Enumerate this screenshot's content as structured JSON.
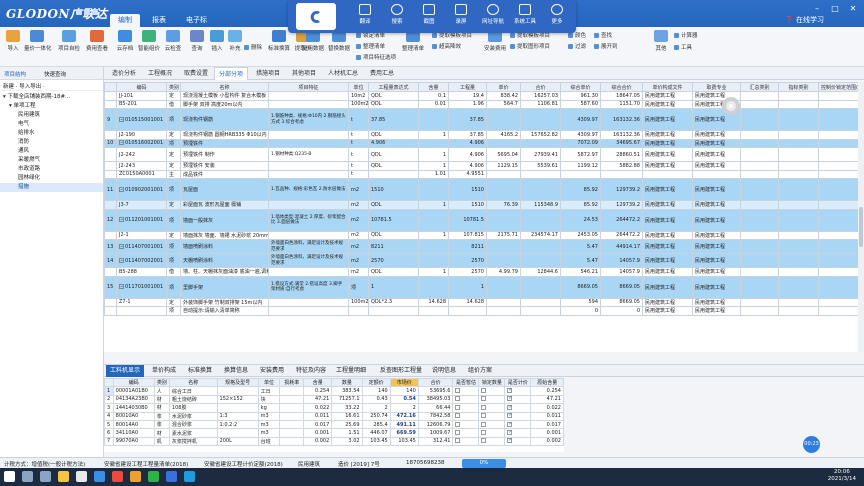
{
  "titlebar": {
    "logo": "GLODON广联达",
    "menu_tabs": [
      "编制",
      "报表",
      "电子标"
    ],
    "online_learning": "在线学习"
  },
  "floating_toolbar": {
    "buttons": [
      "翻译",
      "搜索",
      "截图",
      "录屏",
      "网址导航",
      "系统工具",
      "更多"
    ]
  },
  "ribbon": {
    "buttons": [
      "导入",
      "量价一体化",
      "项目自检",
      "费用查看",
      "云存档",
      "智能组价",
      "云检查",
      "查询",
      "插入",
      "补充",
      "删除",
      "标准换算",
      "提取价",
      "复用数据",
      "替换数据",
      "锁定清单",
      "整理清单",
      "超高降效",
      "安装费用",
      "批量换算",
      "其他",
      "工具"
    ],
    "small": [
      "锁定清单",
      "整理清单",
      "项目特征选项",
      "提取模板项目",
      "提取图形项目",
      "颜色",
      "展开到",
      "查找",
      "过滤",
      "计算器"
    ]
  },
  "left_panel": {
    "tabs": [
      "项目结构",
      "快速查询"
    ],
    "toolbar": "新建 · 导入导出 ·",
    "tree": [
      {
        "label": "下载全店铺装西期-18#...",
        "level": 0
      },
      {
        "label": "单项工程",
        "level": 1
      },
      {
        "label": "民用建筑",
        "level": 2
      },
      {
        "label": "电气",
        "level": 2
      },
      {
        "label": "给排水",
        "level": 2
      },
      {
        "label": "消防",
        "level": 2
      },
      {
        "label": "通风",
        "level": 2
      },
      {
        "label": "采暖燃气",
        "level": 2
      },
      {
        "label": "市政道路",
        "level": 2
      },
      {
        "label": "园林绿化",
        "level": 2
      },
      {
        "label": "措施",
        "level": 2,
        "selected": true
      }
    ]
  },
  "content_tabs": [
    "造价分析",
    "工程概况",
    "取费设置",
    "分部分项",
    "措施项目",
    "其他项目",
    "人材机汇总",
    "费用汇总"
  ],
  "active_content_tab": "分部分项",
  "grid": {
    "headers": [
      "",
      "编码",
      "类别",
      "名称",
      "项目特征",
      "单位",
      "工程量表达式",
      "含量",
      "工程量",
      "单价",
      "合价",
      "综合单价",
      "综合合价",
      "单价构成文件",
      "取费专业",
      "汇总类别",
      "指标类别",
      "控制价锁定范围(%)"
    ],
    "rows": [
      {
        "no": "",
        "code": "JJ-101",
        "cat": "定",
        "name": "现浇混凝土模板 小型构件 复合木模板",
        "feat": "",
        "unit": "10m2",
        "expr": "QDL",
        "qty": "0.1",
        "amount": "19.4",
        "price": "838.42",
        "total": "16257.03",
        "cunit": "961.30",
        "ctotal": "18647.05",
        "file": "民用建筑工程",
        "spec": "民用建筑工程",
        "style": "white"
      },
      {
        "no": "",
        "code": "B5-201",
        "cat": "借",
        "name": "脚手架 双排 高度20m以内",
        "feat": "",
        "unit": "100m2",
        "expr": "QDL",
        "qty": "0.01",
        "amount": "1.96",
        "price": "564.7",
        "total": "1106.81",
        "cunit": "587.60",
        "ctotal": "1151.70",
        "file": "民用建筑工程",
        "spec": "民用建筑工程",
        "style": "white"
      },
      {
        "no": "9",
        "code": "010515001001",
        "cat": "项",
        "name": "现浇构件钢筋",
        "feat": "1.钢筋种类、规格:Φ10内\n2.钢筋接头方式\n3.综合考虑",
        "unit": "t",
        "expr": "37.85",
        "qty": "",
        "amount": "37.85",
        "price": "",
        "total": "",
        "cunit": "4309.97",
        "ctotal": "163132.36",
        "file": "民用建筑工程",
        "spec": "民用建筑工程",
        "style": "blue"
      },
      {
        "no": "",
        "code": "J2-190",
        "cat": "定",
        "name": "现浇构件钢筋 圆钢HRB335 Φ10以内",
        "feat": "",
        "unit": "t",
        "expr": "QDL",
        "qty": "1",
        "amount": "37.85",
        "price": "4165.2",
        "total": "157652.82",
        "cunit": "4309.97",
        "ctotal": "163132.36",
        "file": "民用建筑工程",
        "spec": "民用建筑工程",
        "style": "white"
      },
      {
        "no": "10",
        "code": "010516002001",
        "cat": "项",
        "name": "预埋铁件",
        "feat": "",
        "unit": "t",
        "expr": "4.906",
        "qty": "",
        "amount": "4.906",
        "price": "",
        "total": "",
        "cunit": "7072.09",
        "ctotal": "34695.67",
        "file": "民用建筑工程",
        "spec": "民用建筑工程",
        "style": "blue"
      },
      {
        "no": "",
        "code": "J2-242",
        "cat": "定",
        "name": "预埋铁件 制作",
        "feat": "1.钢材种类:Q235-B",
        "unit": "t",
        "expr": "QDL",
        "qty": "1",
        "amount": "4.906",
        "price": "5695.04",
        "total": "27939.41",
        "cunit": "5872.97",
        "ctotal": "28860.51",
        "file": "民用建筑工程",
        "spec": "民用建筑工程",
        "style": "white"
      },
      {
        "no": "",
        "code": "J2-243",
        "cat": "定",
        "name": "预埋铁件 安装",
        "feat": "",
        "unit": "t",
        "expr": "QDL",
        "qty": "1",
        "amount": "4.906",
        "price": "1129.15",
        "total": "5539.61",
        "cunit": "1199.12",
        "ctotal": "5882.88",
        "file": "民用建筑工程",
        "spec": "民用建筑工程",
        "style": "white"
      },
      {
        "no": "",
        "code": "ZC0150A0001",
        "cat": "主",
        "name": "成品铁件",
        "feat": "",
        "unit": "t",
        "expr": "",
        "qty": "1.01",
        "amount": "4.9551",
        "price": "",
        "total": "",
        "cunit": "",
        "ctotal": "",
        "file": "",
        "spec": "",
        "style": "white"
      },
      {
        "no": "11",
        "code": "010902001001",
        "cat": "项",
        "name": "瓦屋面",
        "feat": "1.瓦品种、规格:彩色瓦\n2.防水层做法",
        "unit": "m2",
        "expr": "1510",
        "qty": "",
        "amount": "1510",
        "price": "",
        "total": "",
        "cunit": "85.92",
        "ctotal": "129739.2",
        "file": "民用建筑工程",
        "spec": "民用建筑工程",
        "style": "blue"
      },
      {
        "no": "",
        "code": "J3-7",
        "cat": "定",
        "name": "彩屋面瓦 波形瓦屋面 檩铺",
        "feat": "",
        "unit": "m2",
        "expr": "QDL",
        "qty": "1",
        "amount": "1510",
        "price": "76.39",
        "total": "115348.9",
        "cunit": "85.92",
        "ctotal": "129739.2",
        "file": "民用建筑工程",
        "spec": "民用建筑工程",
        "style": "lblue"
      },
      {
        "no": "12",
        "code": "011201001001",
        "cat": "项",
        "name": "墙面一般抹灰",
        "feat": "1.墙体类型:混凝土\n2.厚度、砂浆配合比\n3.面层做法",
        "unit": "m2",
        "expr": "10781.5",
        "qty": "",
        "amount": "10781.5",
        "price": "",
        "total": "",
        "cunit": "24.53",
        "ctotal": "264472.2",
        "file": "民用建筑工程",
        "spec": "民用建筑工程",
        "style": "blue"
      },
      {
        "no": "",
        "code": "J2-1",
        "cat": "定",
        "name": "墙面抹灰 墙面、墙裙 水泥砂浆 20mm",
        "feat": "",
        "unit": "m2",
        "expr": "QDL",
        "qty": "1",
        "amount": "107.815",
        "price": "2175.71",
        "total": "234574.17",
        "cunit": "2453.05",
        "ctotal": "264472.2",
        "file": "民用建筑工程",
        "spec": "民用建筑工程",
        "style": "white"
      },
      {
        "no": "13",
        "code": "011407001001",
        "cat": "项",
        "name": "墙面喷刷涂料",
        "feat": "外墙面白色涂料，满足设计及技术规范要求",
        "unit": "m2",
        "expr": "8211",
        "qty": "",
        "amount": "8211",
        "price": "",
        "total": "",
        "cunit": "5.47",
        "ctotal": "44914.17",
        "file": "民用建筑工程",
        "spec": "民用建筑工程",
        "style": "blue"
      },
      {
        "no": "14",
        "code": "011407002001",
        "cat": "项",
        "name": "天棚喷刷涂料",
        "feat": "外墙面白色涂料，满足设计及技术规范要求",
        "unit": "m2",
        "expr": "2570",
        "qty": "",
        "amount": "2570",
        "price": "",
        "total": "",
        "cunit": "5.47",
        "ctotal": "14057.9",
        "file": "民用建筑工程",
        "spec": "民用建筑工程",
        "style": "blue"
      },
      {
        "no": "",
        "code": "B5-288",
        "cat": "借",
        "name": "墙、柱、天棚抹灰面油漆 底油一遍,调和漆二遍",
        "feat": "",
        "unit": "m2",
        "expr": "QDL",
        "qty": "1",
        "amount": "2570",
        "price": "4.99.79",
        "total": "12844.6",
        "cunit": "546.21",
        "ctotal": "14057.9",
        "file": "民用建筑工程",
        "spec": "民用建筑工程",
        "style": "white"
      },
      {
        "no": "15",
        "code": "011701001001",
        "cat": "项",
        "name": "里脚手架",
        "feat": "1.搭设方式:满堂\n2.搭设高度\n3.脚手架材质:自行考虑",
        "unit": "项",
        "expr": "1",
        "qty": "",
        "amount": "1",
        "price": "",
        "total": "",
        "cunit": "8669.05",
        "ctotal": "8669.05",
        "file": "民用建筑工程",
        "spec": "民用建筑工程",
        "style": "blue"
      },
      {
        "no": "",
        "code": "Z7-1",
        "cat": "定",
        "name": "外装饰脚手架 竹制双排架 15m以内",
        "feat": "",
        "unit": "100m2",
        "expr": "QDL*2.3",
        "qty": "14.628",
        "amount": "14.628",
        "price": "",
        "total": "",
        "cunit": "594",
        "ctotal": "8669.05",
        "file": "民用建筑工程",
        "spec": "民用建筑工程",
        "style": "white"
      },
      {
        "no": "",
        "code": "",
        "cat": "项",
        "name": "自动提示:请输入清单简称",
        "feat": "",
        "unit": "",
        "expr": "",
        "qty": "",
        "amount": "",
        "price": "",
        "total": "",
        "cunit": "0",
        "ctotal": "0",
        "file": "民用建筑工程",
        "spec": "民用建筑工程",
        "style": "white"
      }
    ]
  },
  "bottom_tabs": [
    "工料机显示",
    "单价构成",
    "标准换算",
    "换算信息",
    "安装费用",
    "特征及内容",
    "工程量明细",
    "反查图形工程量",
    "说明信息",
    "组价方案"
  ],
  "bottom_grid": {
    "headers": [
      "编码",
      "类别",
      "名称",
      "规格及型号",
      "单位",
      "损耗率",
      "含量",
      "数量",
      "定额价",
      "市场价",
      "合价",
      "是否暂估",
      "锁定数量",
      "是否计价",
      "原始含量"
    ],
    "rows": [
      {
        "no": "1",
        "code": "00001A01B0",
        "cat": "人",
        "name": "综合工日",
        "spec": "",
        "unit": "工日",
        "loss": "",
        "content": "0.254",
        "qty": "383.54",
        "quota": "140",
        "market": "140",
        "total": "53695.6",
        "pricing": true,
        "orig": "0.254"
      },
      {
        "no": "2",
        "code": "04134A23B0",
        "cat": "材",
        "name": "粗土烧结砖",
        "spec": "152×152",
        "unit": "块",
        "loss": "",
        "content": "47.21",
        "qty": "71257.1",
        "quota": "0.43",
        "market": "0.54",
        "total": "38495.03",
        "pricing": true,
        "orig": "47.21"
      },
      {
        "no": "3",
        "code": "14414030B0",
        "cat": "材",
        "name": "108胶",
        "spec": "",
        "unit": "kg",
        "loss": "",
        "content": "0.022",
        "qty": "33.22",
        "quota": "2",
        "market": "2",
        "total": "66.44",
        "pricing": true,
        "orig": "0.022"
      },
      {
        "no": "4",
        "code": "80010A0",
        "cat": "浆",
        "name": "水泥砂浆",
        "spec": "1:3",
        "unit": "m3",
        "loss": "",
        "content": "0.011",
        "qty": "16.61",
        "quota": "250.74",
        "market": "472.16",
        "total": "7842.58",
        "pricing": true,
        "orig": "0.011"
      },
      {
        "no": "5",
        "code": "80014A0",
        "cat": "浆",
        "name": "混合砂浆",
        "spec": "1:0.2:2",
        "unit": "m3",
        "loss": "",
        "content": "0.017",
        "qty": "25.69",
        "quota": "285.4",
        "market": "491.11",
        "total": "12606.79",
        "pricing": true,
        "orig": "0.017"
      },
      {
        "no": "6",
        "code": "34110A0",
        "cat": "材",
        "name": "素水泥浆",
        "spec": "",
        "unit": "m3",
        "loss": "",
        "content": "0.001",
        "qty": "1.51",
        "quota": "446.07",
        "market": "669.59",
        "total": "1009.67",
        "pricing": true,
        "orig": "0.001"
      },
      {
        "no": "7",
        "code": "99070A0",
        "cat": "机",
        "name": "灰浆搅拌机",
        "spec": "200L",
        "unit": "台班",
        "loss": "",
        "content": "0.002",
        "qty": "3.02",
        "quota": "103.45",
        "market": "103.45",
        "total": "312.41",
        "pricing": true,
        "orig": "0.002"
      }
    ]
  },
  "timer": "00:23",
  "statusbar": {
    "items": [
      "计税方式：增值税(一般计税方法)",
      "安徽省建设工程工程量清单(2018)",
      "安徽省建设工程计价定额(2018)",
      "民用建筑",
      "造价 [2019] 7号",
      "18705698238"
    ],
    "pill": "0%"
  },
  "taskbar": {
    "time": "20:06",
    "date": "2021/3/14"
  }
}
